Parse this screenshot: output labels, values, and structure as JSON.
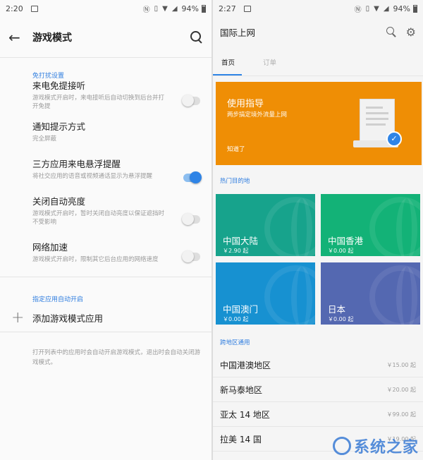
{
  "left": {
    "status": {
      "time": "2:20",
      "battery": "94%"
    },
    "header": {
      "title": "游戏模式"
    },
    "sections": [
      {
        "label": "免打扰设置",
        "items": [
          {
            "title": "来电免提接听",
            "subtitle": "游戏模式开启时，来电接听后自动切换到后台并打开免提",
            "toggle": "off"
          },
          {
            "title": "通知提示方式",
            "subtitle": "完全屏蔽"
          },
          {
            "title": "三方应用来电悬浮提醒",
            "subtitle": "将社交应用的语音或视频通话显示为悬浮提醒",
            "toggle": "on"
          },
          {
            "title": "关闭自动亮度",
            "subtitle": "游戏模式开启时，暂时关闭自动亮度以保证遮挡时不受影响",
            "toggle": "off"
          },
          {
            "title": "网络加速",
            "subtitle": "游戏模式开启时，限制其它后台应用的网络速度",
            "toggle": "off"
          }
        ]
      }
    ],
    "auto_section": {
      "label": "指定应用自动开启",
      "add_label": "添加游戏模式应用"
    },
    "note": "打开列表中的应用时会自动开启游戏模式，退出时会自动关闭游戏模式。"
  },
  "right": {
    "status": {
      "time": "2:27",
      "battery": "94%"
    },
    "header": {
      "title": "国际上网"
    },
    "tabs": [
      {
        "label": "首页",
        "active": true
      },
      {
        "label": "订单",
        "active": false
      }
    ],
    "guide": {
      "title": "使用指导",
      "subtitle": "两步搞定境外流量上网",
      "dismiss": "知道了"
    },
    "hot_label": "热门目的地",
    "destinations": [
      {
        "name": "中国大陆",
        "price": "￥2.90 起",
        "color": "#17a38c"
      },
      {
        "name": "中国香港",
        "price": "￥0.00 起",
        "color": "#13b277"
      },
      {
        "name": "中国澳门",
        "price": "￥0.00 起",
        "color": "#1791d1"
      },
      {
        "name": "日本",
        "price": "￥0.00 起",
        "color": "#5468b1"
      }
    ],
    "cross_label": "跨地区通用",
    "regions": [
      {
        "name": "中国港澳地区",
        "price": "￥15.00 起"
      },
      {
        "name": "新马泰地区",
        "price": "￥20.00 起"
      },
      {
        "name": "亚太 14 地区",
        "price": "￥99.00 起"
      },
      {
        "name": "拉美 14 国",
        "price": "￥19.00 起"
      }
    ]
  },
  "watermark": {
    "text": "系统之家"
  },
  "colors": {
    "accent": "#2f84e6",
    "orange": "#ef8e05"
  }
}
